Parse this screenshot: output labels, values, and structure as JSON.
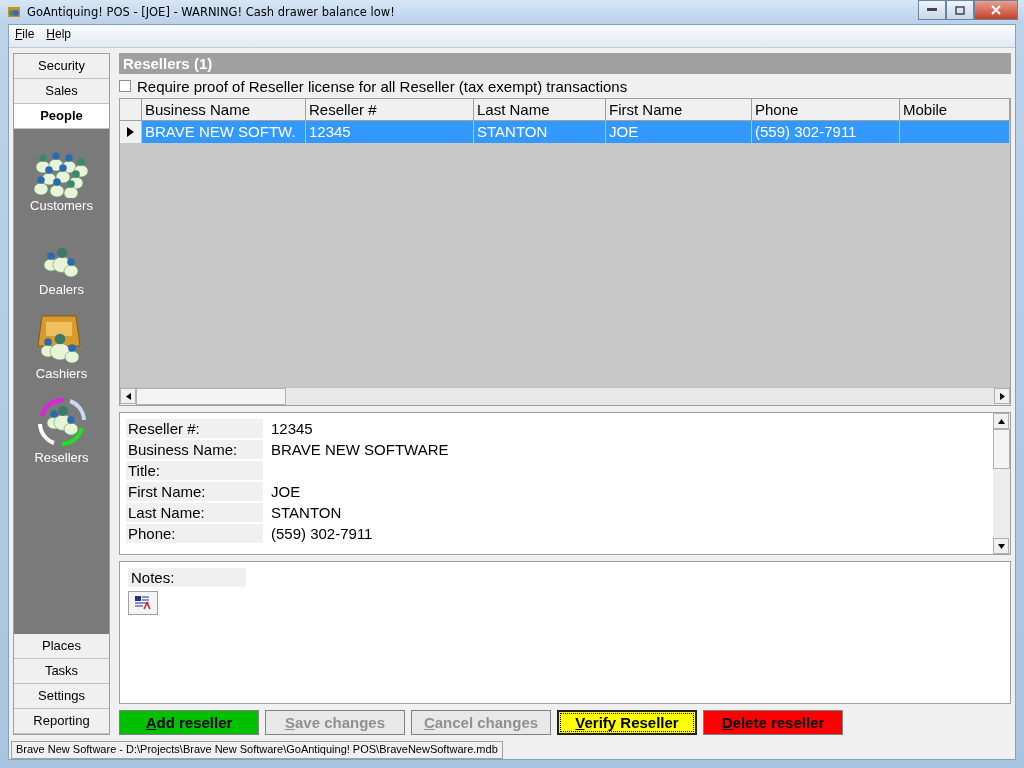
{
  "window": {
    "title": "GoAntiquing! POS - [JOE] - WARNING! Cash drawer balance low!"
  },
  "menu": [
    "File",
    "Help"
  ],
  "nav": {
    "top": [
      {
        "label": "Security",
        "selected": false
      },
      {
        "label": "Sales",
        "selected": false
      },
      {
        "label": "People",
        "selected": true
      }
    ],
    "items": [
      {
        "label": "Customers",
        "kind": "crowd"
      },
      {
        "label": "Dealers",
        "kind": "group"
      },
      {
        "label": "Cashiers",
        "kind": "register"
      },
      {
        "label": "Resellers",
        "kind": "cycle"
      }
    ],
    "bottom": [
      {
        "label": "Places",
        "selected": false
      },
      {
        "label": "Tasks",
        "selected": false
      },
      {
        "label": "Settings",
        "selected": false
      },
      {
        "label": "Reporting",
        "selected": false
      }
    ]
  },
  "panel": {
    "title": "Resellers (1)",
    "require_proof": {
      "label": "Require proof of Reseller license for all Reseller (tax exempt) transactions",
      "checked": false
    }
  },
  "table": {
    "columns": [
      "Business Name",
      "Reseller #",
      "Last Name",
      "First Name",
      "Phone",
      "Mobile"
    ],
    "rows": [
      {
        "selected": true,
        "cells": [
          "BRAVE NEW SOFTW.",
          "12345",
          "STANTON",
          "JOE",
          "(559) 302-7911"
        ]
      }
    ]
  },
  "details": [
    {
      "label": "Reseller #:",
      "value": "12345"
    },
    {
      "label": "Business Name:",
      "value": "BRAVE NEW SOFTWARE"
    },
    {
      "label": "Title:"
    },
    {
      "label": "First Name:",
      "value": "JOE"
    },
    {
      "label": "Last Name:",
      "value": "STANTON"
    },
    {
      "label": "Phone:",
      "value": "(559) 302-7911"
    }
  ],
  "notes": {
    "label": "Notes:"
  },
  "buttons": [
    {
      "label": "Add reseller",
      "color": "#00c000",
      "disabled": false,
      "focused": false
    },
    {
      "label": "Save changes",
      "color": "#e8e8e8",
      "disabled": true,
      "focused": false
    },
    {
      "label": "Cancel changes",
      "color": "#e8e8e8",
      "disabled": true,
      "focused": false
    },
    {
      "label": "Verify Reseller",
      "color": "#ffff00",
      "disabled": false,
      "focused": true
    },
    {
      "label": "Delete reseller",
      "color": "#ff0000",
      "disabled": false,
      "focused": false
    }
  ],
  "status_bar": "Brave New Software - D:\\Projects\\Brave New Software\\GoAntiquing! POS\\BraveNewSoftware.mdb"
}
